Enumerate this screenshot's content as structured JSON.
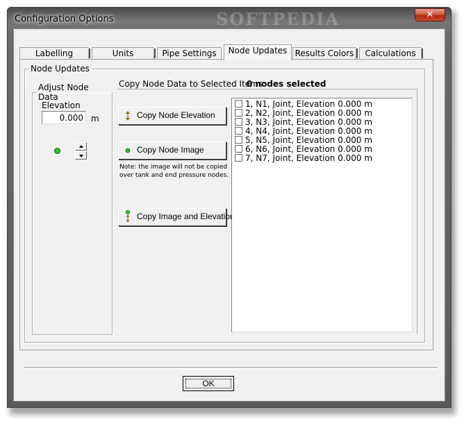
{
  "window": {
    "title": "Configuration Options",
    "watermark": "SOFTPEDIA",
    "close_glyph": "✕"
  },
  "tabs": [
    {
      "label": "Labelling",
      "active": false
    },
    {
      "label": "Units",
      "active": false
    },
    {
      "label": "Pipe Settings",
      "active": false
    },
    {
      "label": "Node Updates",
      "active": true
    },
    {
      "label": "Results Colors",
      "active": false
    },
    {
      "label": "Calculations",
      "active": false
    }
  ],
  "node_updates": {
    "group_title": "Node Updates",
    "adjust": {
      "group_title": "Adjust Node Data",
      "elevation_label": "Elevation",
      "elevation_value": "0.000",
      "elevation_unit": "m",
      "node_color": "#2fbf2f"
    },
    "copy": {
      "heading": "Copy Node Data to Selected Items:",
      "selected_count": "0 nodes selected",
      "copy_elevation_label": "Copy Node Elevation",
      "copy_image_label": "Copy Node Image",
      "note_line1": "Note: the image will not be copied",
      "note_line2": "over tank and end pressure nodes.",
      "copy_both_label": "Copy Image and Elevation"
    },
    "nodes": [
      {
        "label": "1, N1, Joint, Elevation 0.000 m",
        "checked": false
      },
      {
        "label": "2, N2, Joint, Elevation 0.000 m",
        "checked": false
      },
      {
        "label": "3, N3, Joint, Elevation 0.000 m",
        "checked": false
      },
      {
        "label": "4, N4, Joint, Elevation 0.000 m",
        "checked": false
      },
      {
        "label": "5, N5, Joint, Elevation 0.000 m",
        "checked": false
      },
      {
        "label": "6, N6, Joint, Elevation 0.000 m",
        "checked": false
      },
      {
        "label": "7, N7, Joint, Elevation 0.000 m",
        "checked": false
      }
    ]
  },
  "footer": {
    "ok_label": "OK"
  }
}
